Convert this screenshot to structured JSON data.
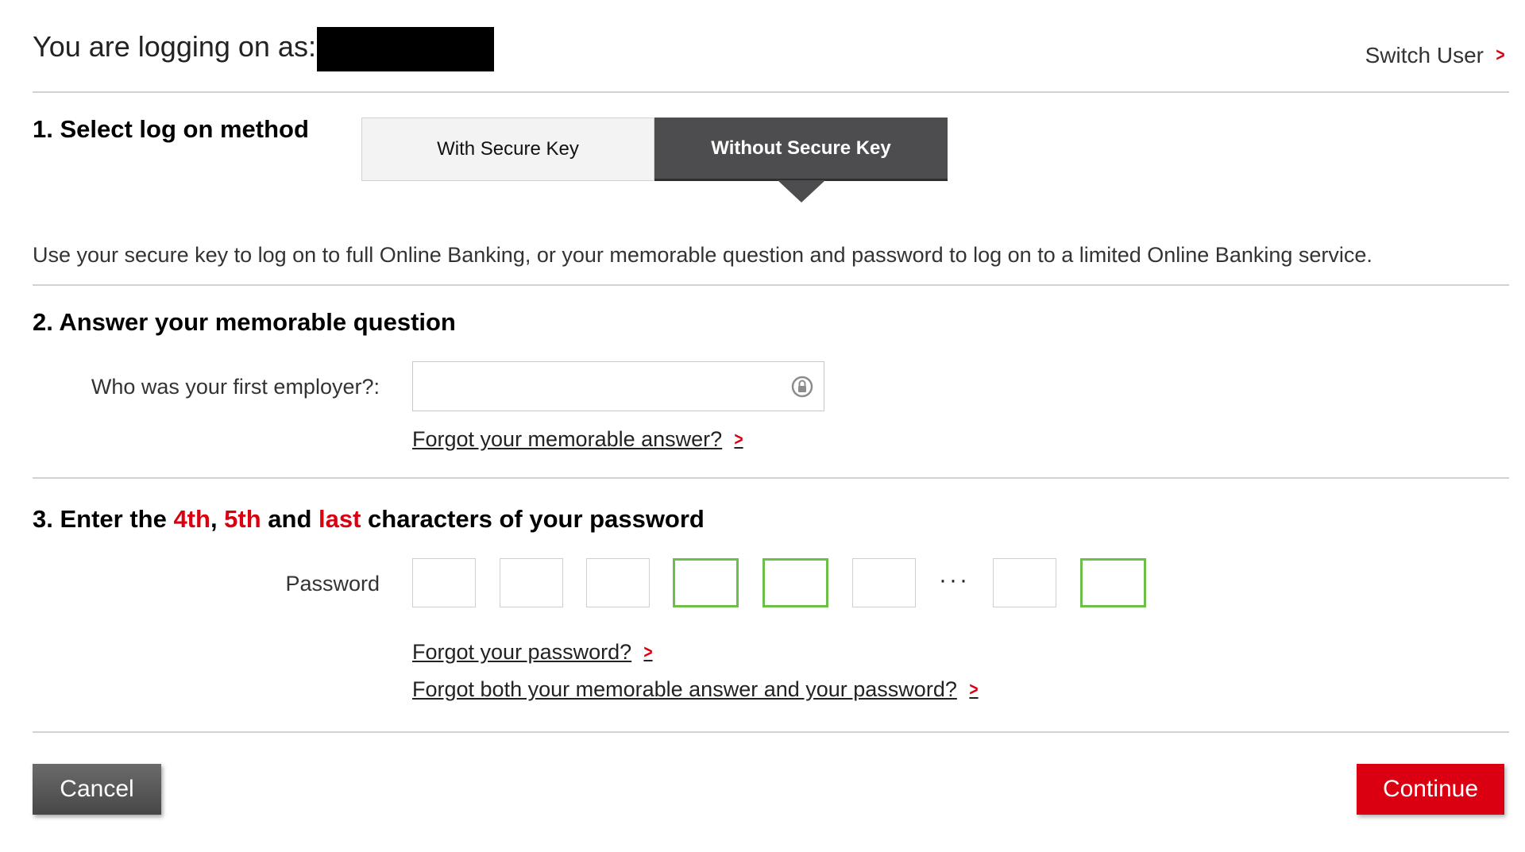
{
  "header": {
    "logging_on_label": "You are logging on as:",
    "switch_user_label": "Switch User"
  },
  "step1": {
    "title": "1. Select log on method",
    "options": [
      {
        "label": "With Secure Key",
        "selected": false
      },
      {
        "label": "Without Secure Key",
        "selected": true
      }
    ],
    "description": "Use your secure key to log on to full Online Banking, or your memorable question and password to log on to a limited Online Banking service."
  },
  "step2": {
    "title": "2. Answer your memorable question",
    "question_label": "Who was your first employer?:",
    "answer_value": "",
    "forgot_answer_link": "Forgot your memorable answer?"
  },
  "step3": {
    "title_prefix": "3. Enter the ",
    "title_char1": "4th",
    "title_sep1": ", ",
    "title_char2": "5th",
    "title_sep2": " and ",
    "title_char3": "last",
    "title_suffix": " characters of your password",
    "password_label": "Password",
    "ellipsis": "···",
    "boxes": [
      {
        "position": 1,
        "active": false
      },
      {
        "position": 2,
        "active": false
      },
      {
        "position": 3,
        "active": false
      },
      {
        "position": 4,
        "active": true
      },
      {
        "position": 5,
        "active": true
      },
      {
        "position": 6,
        "active": false
      },
      {
        "position": "second-last",
        "active": false
      },
      {
        "position": "last",
        "active": true
      }
    ],
    "forgot_password_link": "Forgot your password?",
    "forgot_both_link": "Forgot both your memorable answer and your password?"
  },
  "actions": {
    "cancel_label": "Cancel",
    "continue_label": "Continue"
  },
  "colors": {
    "accent_red": "#db0011",
    "active_box_green": "#6cc04a",
    "segment_selected": "#4d4d4f",
    "cancel_button": "#5a5a5a"
  },
  "icons": {
    "chevron": "chevron-right-icon",
    "input_lock": "lock-icon"
  }
}
